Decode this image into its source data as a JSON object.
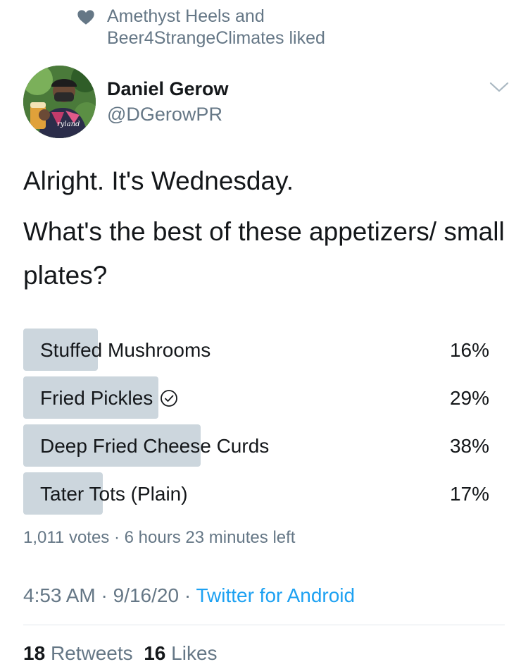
{
  "social_context": {
    "icon": "heart-icon",
    "text": "Amethyst Heels and Beer4StrangeClimates liked"
  },
  "author": {
    "name": "Daniel Gerow",
    "handle": "@DGerowPR",
    "avatar_text": "ryland"
  },
  "tweet": {
    "line1": "Alright. It's Wednesday.",
    "line2": "What's the best of these appetizers/ small plates?"
  },
  "poll": {
    "options": [
      {
        "label": "Stuffed Mushrooms",
        "percent_text": "16%",
        "percent": 16,
        "selected": false
      },
      {
        "label": "Fried Pickles",
        "percent_text": "29%",
        "percent": 29,
        "selected": true
      },
      {
        "label": "Deep Fried Cheese Curds",
        "percent_text": "38%",
        "percent": 38,
        "selected": false
      },
      {
        "label": "Tater Tots (Plain)",
        "percent_text": "17%",
        "percent": 17,
        "selected": false
      }
    ],
    "votes": "1,011 votes",
    "separator": "·",
    "time_left": "6 hours 23 minutes left"
  },
  "meta": {
    "time": "4:53 AM",
    "separator": "·",
    "date": "9/16/20",
    "source": "Twitter for Android"
  },
  "stats": {
    "retweets_count": "18",
    "retweets_label": "Retweets",
    "likes_count": "16",
    "likes_label": "Likes"
  },
  "colors": {
    "accent": "#1da1f2",
    "secondary_text": "#657786",
    "poll_bar": "#ccd6dd",
    "primary_text": "#14171a"
  }
}
